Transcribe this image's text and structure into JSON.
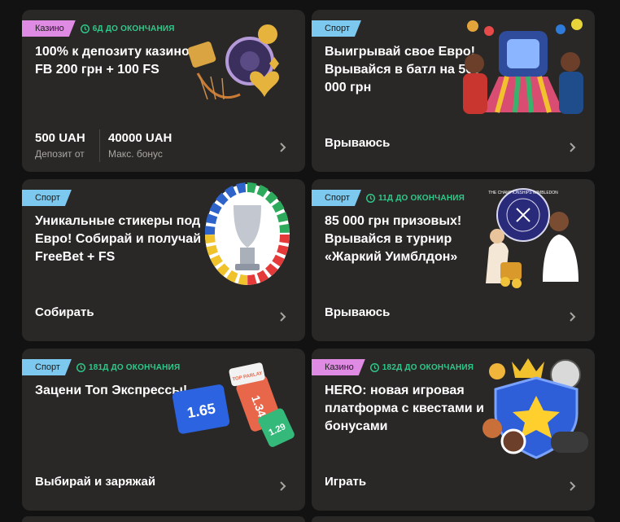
{
  "cards": [
    {
      "category": "Казино",
      "timer": "6Д ДО ОКОНЧАНИЯ",
      "title": "100% к депозиту казино + FB 200 грн + 100 FS",
      "stats": [
        {
          "value": "500 UAH",
          "label": "Депозит от"
        },
        {
          "value": "40000 UAH",
          "label": "Макс. бонус"
        }
      ],
      "art": "casino-chips-icon"
    },
    {
      "category": "Спорт",
      "title": "Выигрывай свое Евро! Врывайся в батл на 500 000 грн",
      "cta": "Врываюсь",
      "art": "euro-stadium-icon"
    },
    {
      "category": "Спорт",
      "title": "Уникальные стикеры под Евро! Собирай и получай FreeBet + FS",
      "cta": "Собирать",
      "art": "euro-trophy-icon"
    },
    {
      "category": "Спорт",
      "timer": "11Д ДО ОКОНЧАНИЯ",
      "title": "85 000 грн призовых! Врывайся в турнир «Жаркий Уимблдон»",
      "cta": "Врываюсь",
      "art": "tennis-icon",
      "art_text": "THE CHAMPIONSHIPS WIMBLEDON"
    },
    {
      "category": "Спорт",
      "timer": "181Д ДО ОКОНЧАНИЯ",
      "title": "Зацени Топ Экспрессы!",
      "cta": "Выбирай и заряжай",
      "art": "tickets-icon",
      "tickets": [
        "1.65",
        "1.34",
        "1.29"
      ],
      "ticket_tag": "TOP PARLAY"
    },
    {
      "category": "Казино",
      "timer": "182Д ДО ОКОНЧАНИЯ",
      "title": "HERO: новая игровая платформа с квестами и бонусами",
      "cta": "Играть",
      "art": "hero-shield-icon"
    }
  ],
  "colors": {
    "page_bg": "#121212",
    "card_bg": "#2a2826",
    "casino_badge": "#e08be3",
    "sport_badge": "#7cc8ee",
    "timer": "#2ec98a"
  }
}
